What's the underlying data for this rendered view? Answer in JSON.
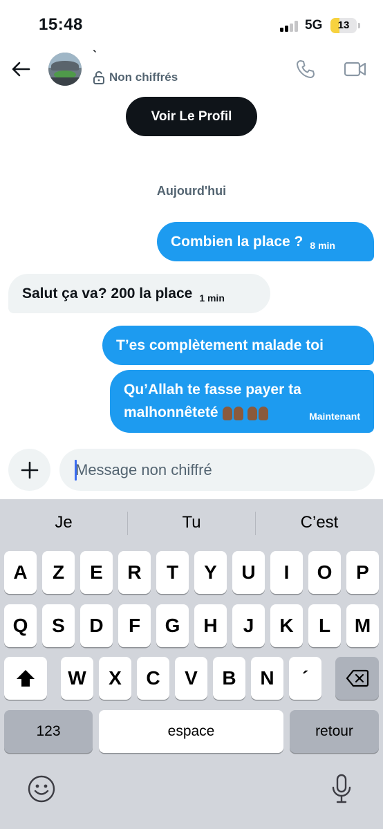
{
  "status_bar": {
    "time": "15:48",
    "network": "5G",
    "battery": "13",
    "battery_level_percent": 13
  },
  "header": {
    "back_icon": "back-arrow-icon",
    "contact_name": "`",
    "encryption_label": "Non chiffrés",
    "lock_icon": "unlock-icon",
    "call_icon": "phone-icon",
    "video_icon": "video-camera-icon"
  },
  "profile_button": "Voir Le Profil",
  "date_separator": "Aujourd'hui",
  "messages": [
    {
      "direction": "outgoing",
      "text": "Combien la place ?",
      "time": "8 min"
    },
    {
      "direction": "incoming",
      "text": "Salut ça va? 200 la place",
      "time": "1 min"
    },
    {
      "direction": "outgoing",
      "text": "T’es complètement malade toi",
      "time": ""
    },
    {
      "direction": "outgoing",
      "line1": "Qu’Allah te fasse payer ta",
      "line2": "malhonnêteté",
      "emoji": "praying-hands-icon",
      "time": "Maintenant"
    }
  ],
  "composer": {
    "placeholder": "Message non chiffré",
    "add_icon": "plus-icon"
  },
  "keyboard": {
    "suggestions": [
      "Je",
      "Tu",
      "C’est"
    ],
    "row1": [
      "A",
      "Z",
      "E",
      "R",
      "T",
      "Y",
      "U",
      "I",
      "O",
      "P"
    ],
    "row2": [
      "Q",
      "S",
      "D",
      "F",
      "G",
      "H",
      "J",
      "K",
      "L",
      "M"
    ],
    "row3": [
      "W",
      "X",
      "C",
      "V",
      "B",
      "N",
      "´"
    ],
    "numbers_label": "123",
    "space_label": "espace",
    "return_label": "retour",
    "icons": [
      "shift-icon",
      "backspace-icon",
      "emoji-icon",
      "microphone-icon"
    ],
    "colors": {
      "keyboard_bg": "#d2d5db",
      "key_bg": "#ffffff",
      "special_key_bg": "#adb2bb"
    }
  },
  "colors": {
    "outgoing_bubble": "#1d9bf0",
    "incoming_bubble": "#eff3f4",
    "secondary_text": "#536471",
    "primary_text": "#0f1419"
  }
}
